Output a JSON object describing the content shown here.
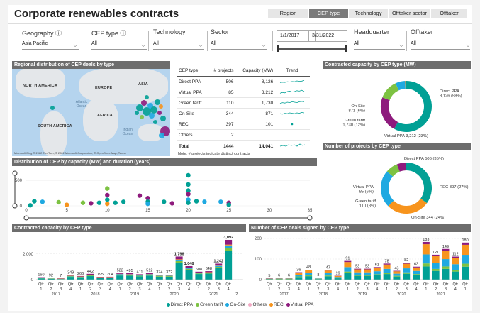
{
  "header": {
    "title": "Corporate renewables contracts",
    "tabs": [
      {
        "label": "Region",
        "active": false
      },
      {
        "label": "CEP type",
        "active": true
      },
      {
        "label": "Technology",
        "active": false
      },
      {
        "label": "Offtaker sector",
        "active": false
      },
      {
        "label": "Offtaker",
        "active": false
      }
    ]
  },
  "filters": {
    "geography": {
      "label": "Geography",
      "value": "Asia Pacific"
    },
    "cep_type": {
      "label": "CEP type",
      "value": "All"
    },
    "technology": {
      "label": "Technology",
      "value": "All"
    },
    "sector": {
      "label": "Sector",
      "value": "All"
    },
    "date_start": "1/1/2017",
    "date_end": "3/31/2022",
    "headquarter": {
      "label": "Headquarter",
      "value": "All"
    },
    "offtaker": {
      "label": "Offtaker",
      "value": "All"
    }
  },
  "panels": {
    "map_title": "Regional distribution of CEP deals by type",
    "donut1_title": "Contracted capacity by CEP type (MW)",
    "donut2_title": "Number of projects by CEP type",
    "scatter_title": "Distribution of CEP by capacity (MW) and duration (years)",
    "bar1_title": "Contracted capacity by CEP type",
    "bar2_title": "Number of CEP deals signed by CEP type"
  },
  "map": {
    "labels": [
      "NORTH AMERICA",
      "EUROPE",
      "ASIA",
      "AFRICA",
      "SOUTH AMERICA"
    ],
    "oceans": [
      "Atlantic Ocean",
      "Indian Ocean"
    ],
    "credit": "Microsoft Bing   © 2022 TomTom, © 2022 Microsoft Corporation, © OpenStreetMap, Terms"
  },
  "table": {
    "headers": [
      "CEP type",
      "# projects",
      "Capacity (MW)",
      "Trend"
    ],
    "rows": [
      {
        "type": "Direct PPA",
        "projects": "506",
        "capacity": "8,126"
      },
      {
        "type": "Virtual PPA",
        "projects": "85",
        "capacity": "3,212"
      },
      {
        "type": "Green tariff",
        "projects": "110",
        "capacity": "1,730"
      },
      {
        "type": "On-Site",
        "projects": "344",
        "capacity": "871"
      },
      {
        "type": "REC",
        "projects": "397",
        "capacity": "101"
      },
      {
        "type": "Others",
        "projects": "2",
        "capacity": ""
      }
    ],
    "total": {
      "type": "Total",
      "projects": "1444",
      "capacity": "14,041"
    },
    "note": "Note: # projects indicate distinct contracts"
  },
  "legend": [
    {
      "name": "Direct PPA",
      "color": "#01A095"
    },
    {
      "name": "Green tariff",
      "color": "#7DC242"
    },
    {
      "name": "On-Site",
      "color": "#1FA9E1"
    },
    {
      "name": "Others",
      "color": "#F2A9C4"
    },
    {
      "name": "REC",
      "color": "#F7941D"
    },
    {
      "name": "Virtual PPA",
      "color": "#8E1B7D"
    }
  ],
  "chart_data": [
    {
      "type": "pie",
      "title": "Contracted capacity by CEP type (MW)",
      "slices": [
        {
          "name": "Direct PPA",
          "value": 8126,
          "label": "Direct PPA\n8,126 (58%)",
          "color": "#01A095"
        },
        {
          "name": "Virtual PPA",
          "value": 3212,
          "label": "Virtual PPA 3,212 (23%)",
          "color": "#8E1B7D"
        },
        {
          "name": "Green tariff",
          "value": 1730,
          "label": "Green tariff\n1,730 (12%)",
          "color": "#7DC242"
        },
        {
          "name": "On-Site",
          "value": 871,
          "label": "On-Site\n871 (6%)",
          "color": "#1FA9E1"
        },
        {
          "name": "REC",
          "value": 101,
          "label": "",
          "color": "#F7941D"
        }
      ]
    },
    {
      "type": "pie",
      "title": "Number of projects by CEP type",
      "slices": [
        {
          "name": "Direct PPA",
          "value": 506,
          "label": "Direct PPA 506 (35%)",
          "color": "#01A095"
        },
        {
          "name": "REC",
          "value": 397,
          "label": "REC 397 (27%)",
          "color": "#F7941D"
        },
        {
          "name": "On-Site",
          "value": 344,
          "label": "On-Site 344 (24%)",
          "color": "#1FA9E1"
        },
        {
          "name": "Green tariff",
          "value": 110,
          "label": "Green tariff\n110 (8%)",
          "color": "#7DC242"
        },
        {
          "name": "Virtual PPA",
          "value": 85,
          "label": "Virtual PPA\n85 (6%)",
          "color": "#8E1B7D"
        },
        {
          "name": "Others",
          "value": 2,
          "label": "",
          "color": "#F2A9C4"
        }
      ]
    },
    {
      "type": "scatter",
      "title": "Distribution of CEP by capacity (MW) and duration (years)",
      "xlim": [
        0,
        35
      ],
      "ylim": [
        0,
        600
      ],
      "xticks": [
        "0",
        "5",
        "10",
        "15",
        "20",
        "25",
        "30",
        "35"
      ],
      "yticks": [
        "0",
        "500"
      ],
      "points": [
        {
          "x": 0.5,
          "y": 10,
          "c": "#01A095"
        },
        {
          "x": 1,
          "y": 90,
          "c": "#01A095"
        },
        {
          "x": 2,
          "y": 80,
          "c": "#1FA9E1"
        },
        {
          "x": 4,
          "y": 70,
          "c": "#7DC242"
        },
        {
          "x": 5,
          "y": 20,
          "c": "#F7941D"
        },
        {
          "x": 7,
          "y": 60,
          "c": "#7DC242"
        },
        {
          "x": 8,
          "y": 50,
          "c": "#8E1B7D"
        },
        {
          "x": 9,
          "y": 60,
          "c": "#01A095"
        },
        {
          "x": 10,
          "y": 340,
          "c": "#7DC242"
        },
        {
          "x": 10,
          "y": 210,
          "c": "#8E1B7D"
        },
        {
          "x": 10,
          "y": 120,
          "c": "#01A095"
        },
        {
          "x": 10,
          "y": 40,
          "c": "#F7941D"
        },
        {
          "x": 11,
          "y": 60,
          "c": "#01A095"
        },
        {
          "x": 12,
          "y": 80,
          "c": "#01A095"
        },
        {
          "x": 14,
          "y": 200,
          "c": "#8E1B7D"
        },
        {
          "x": 15,
          "y": 150,
          "c": "#8E1B7D"
        },
        {
          "x": 15,
          "y": 80,
          "c": "#01A095"
        },
        {
          "x": 15,
          "y": 40,
          "c": "#1FA9E1"
        },
        {
          "x": 17,
          "y": 80,
          "c": "#01A095"
        },
        {
          "x": 18,
          "y": 50,
          "c": "#8E1B7D"
        },
        {
          "x": 20,
          "y": 600,
          "c": "#01A095"
        },
        {
          "x": 20,
          "y": 420,
          "c": "#01A095"
        },
        {
          "x": 20,
          "y": 300,
          "c": "#01A095"
        },
        {
          "x": 20,
          "y": 230,
          "c": "#8E1B7D"
        },
        {
          "x": 20,
          "y": 120,
          "c": "#1FA9E1"
        },
        {
          "x": 20,
          "y": 60,
          "c": "#01A095"
        },
        {
          "x": 21,
          "y": 90,
          "c": "#01A095"
        },
        {
          "x": 22,
          "y": 80,
          "c": "#1FA9E1"
        },
        {
          "x": 24,
          "y": 80,
          "c": "#1FA9E1"
        },
        {
          "x": 25,
          "y": 60,
          "c": "#8E1B7D"
        },
        {
          "x": 25,
          "y": 20,
          "c": "#01A095"
        }
      ]
    },
    {
      "type": "bar",
      "title": "Contracted capacity by CEP type",
      "categories": [
        "Qtr 1 2017",
        "Qtr 2 2017",
        "Qtr 3 2017",
        "Qtr 4 2017",
        "Qtr 1 2018",
        "Qtr 2 2018",
        "Qtr 3 2018",
        "Qtr 4 2018",
        "Qtr 1 2019",
        "Qtr 2 2019",
        "Qtr 3 2019",
        "Qtr 4 2019",
        "Qtr 1 2020",
        "Qtr 2 2020",
        "Qtr 3 2020",
        "Qtr 4 2020",
        "Qtr 1 2021",
        "Qtr 2 2021",
        "Qtr 3 2021",
        "Qtr 4 2021",
        "Qtr 1 2022"
      ],
      "totals": [
        160,
        92,
        7,
        349,
        266,
        442,
        195,
        204,
        522,
        495,
        411,
        512,
        374,
        372,
        1796,
        1048,
        608,
        648,
        1242,
        3092,
        null
      ],
      "labels": [
        "160",
        "92",
        "7",
        "349",
        "266",
        "442",
        "195",
        "204",
        "522",
        "495",
        "411",
        "512",
        "374",
        "372",
        "1,796",
        "1,048",
        "608",
        "648",
        "1,242",
        "3,092",
        ""
      ],
      "ylim": [
        0,
        3200
      ],
      "yticks": [
        "0",
        "2,000"
      ],
      "x_groups": [
        "2017",
        "2018",
        "2019",
        "2020",
        "2021",
        "2..."
      ]
    },
    {
      "type": "bar",
      "title": "Number of CEP deals signed by CEP type",
      "categories": [
        "Qtr 1 2017",
        "Qtr 2 2017",
        "Qtr 3 2017",
        "Qtr 4 2017",
        "Qtr 1 2018",
        "Qtr 2 2018",
        "Qtr 3 2018",
        "Qtr 4 2018",
        "Qtr 1 2019",
        "Qtr 2 2019",
        "Qtr 3 2019",
        "Qtr 4 2019",
        "Qtr 1 2020",
        "Qtr 2 2020",
        "Qtr 3 2020",
        "Qtr 4 2020",
        "Qtr 1 2021",
        "Qtr 2 2021",
        "Qtr 3 2021",
        "Qtr 4 2021",
        "Qtr 1 2022"
      ],
      "totals": [
        5,
        6,
        6,
        36,
        48,
        8,
        47,
        19,
        91,
        53,
        53,
        61,
        78,
        43,
        82,
        63,
        183,
        121,
        149,
        112,
        180
      ],
      "ylim": [
        0,
        200
      ],
      "yticks": [
        "0",
        "100",
        "200"
      ],
      "x_groups": [
        "2017",
        "2018",
        "2019",
        "2020",
        "2021"
      ]
    }
  ]
}
